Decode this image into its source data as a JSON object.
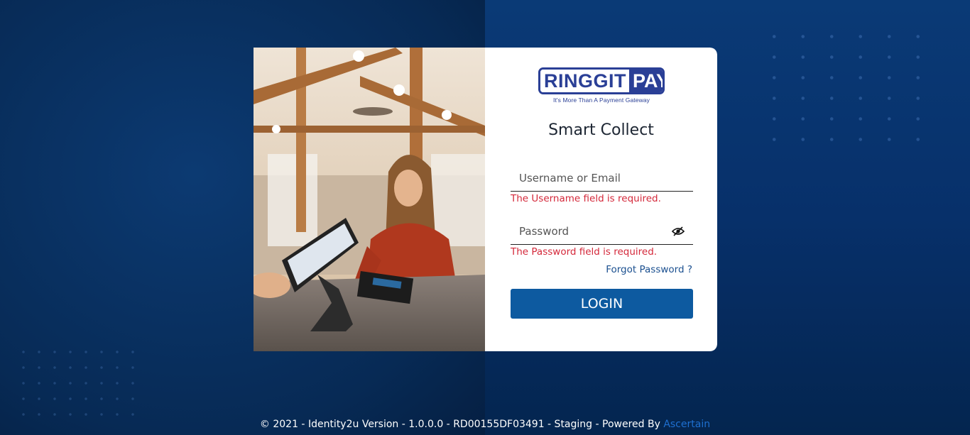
{
  "colors": {
    "accent": "#0d5aa0",
    "brand": "#2a3f96",
    "error": "#d4283a",
    "link": "#1a4f8f",
    "background": "#0a2e5c"
  },
  "logo": {
    "word1": "RINGGIT",
    "word2": "PAY",
    "tagline": "It's More Than A Payment Gateway"
  },
  "form": {
    "title": "Smart Collect",
    "username_placeholder": "Username or Email",
    "username_value": "",
    "username_error": "The Username field is required.",
    "password_placeholder": "Password",
    "password_value": "",
    "password_error": "The Password field is required.",
    "password_toggle_icon": "eye-slash-icon",
    "forgot_label": "Forgot Password ?",
    "login_label": "LOGIN"
  },
  "footer": {
    "text": "© 2021 - Identity2u Version - 1.0.0.0 - RD00155DF03491 - Staging - Powered By",
    "link_label": "Ascertain"
  }
}
